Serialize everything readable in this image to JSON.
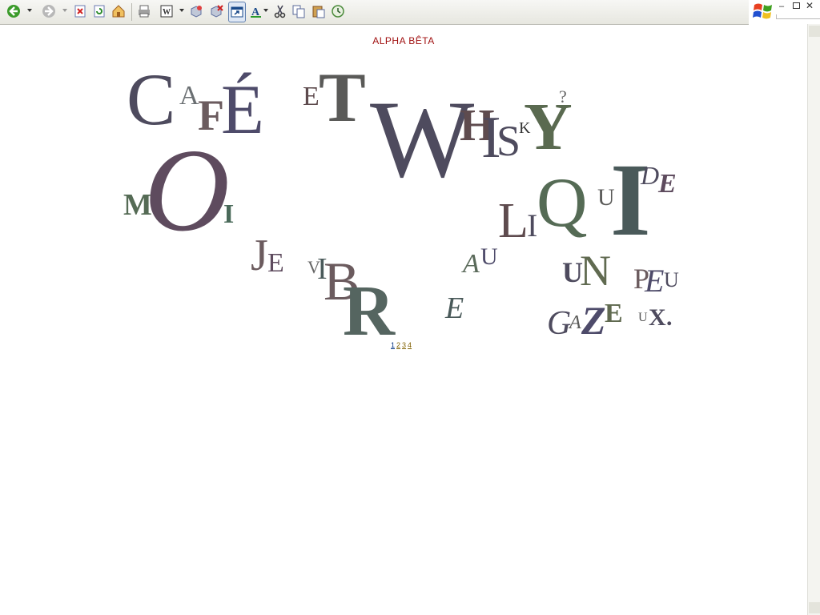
{
  "toolbar": {
    "buttons": [
      "back-icon",
      "forward-icon",
      "stop-icon",
      "refresh-icon",
      "home-icon",
      "print-icon",
      "edit-word-icon",
      "cube-icon",
      "cube-delete-icon",
      "new-window-icon",
      "font-icon",
      "cut-icon",
      "copy-icon",
      "paste-icon",
      "history-icon"
    ]
  },
  "page": {
    "title": "ALPHA BÊTA"
  },
  "colors": {
    "dark": "#4e4b5e",
    "brown": "#6b5b5e",
    "green": "#556b55",
    "slate": "#4a5a5a",
    "olive": "#606a50",
    "title_red": "#a01010"
  },
  "poem": {
    "letters": {
      "C": "C",
      "a1": "A",
      "f": "F",
      "e_acute": "É",
      "e2": "E",
      "t": "T",
      "w": "W",
      "h": "H",
      "i": "I",
      "s": "S",
      "k": "K",
      "y": "Y",
      "q": "?",
      "m": "M",
      "o": "O",
      "i2": "I",
      "j": "J",
      "e3": "E",
      "v": "V",
      "i3": "I",
      "b": "B",
      "r": "R",
      "e4": "E",
      "a2": "A",
      "u": "U",
      "l": "L",
      "i4": "I",
      "q2": "Q",
      "u2": "U",
      "i5": "I",
      "d": "D",
      "e5": "E",
      "u3": "U",
      "n": "N",
      "p": "P",
      "e6": "E",
      "u4": "U",
      "g": "G",
      "a3": "A",
      "z": "Z",
      "e7": "E",
      "u5": "U",
      "x": "X",
      "dot": "."
    }
  },
  "pagination": [
    "1",
    "2",
    "3",
    "4"
  ]
}
